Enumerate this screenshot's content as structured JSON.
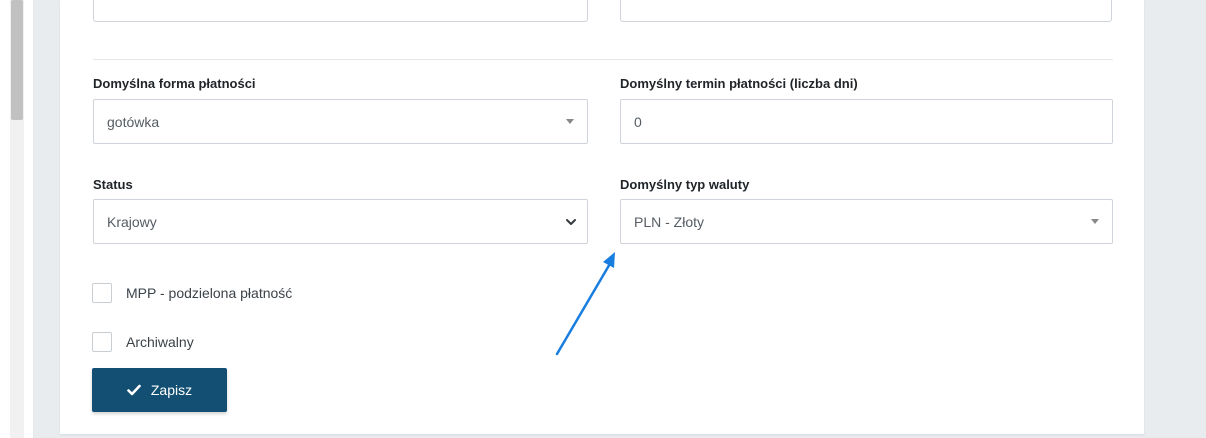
{
  "form": {
    "payment_form": {
      "label": "Domyślna forma płatności",
      "value": "gotówka"
    },
    "payment_term": {
      "label": "Domyślny termin płatności (liczba dni)",
      "value": "0"
    },
    "status": {
      "label": "Status",
      "value": "Krajowy"
    },
    "currency": {
      "label": "Domyślny typ waluty",
      "value": "PLN - Złoty"
    },
    "mpp_checkbox": {
      "label": "MPP - podzielona płatność",
      "checked": false
    },
    "archive_checkbox": {
      "label": "Archiwalny",
      "checked": false
    },
    "save_button": {
      "label": "Zapisz",
      "icon": "check-icon"
    }
  },
  "colors": {
    "primary_button": "#124f73",
    "annotation_arrow": "#1a7de0",
    "page_background": "#e9ecef"
  }
}
